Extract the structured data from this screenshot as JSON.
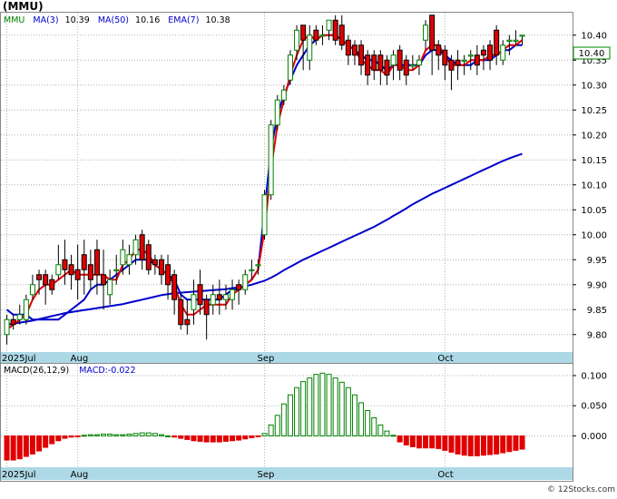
{
  "symbol": "(MMU)",
  "watermark": "© 12Stocks.com",
  "legend": {
    "ticker": "MMU",
    "ma3_label": "MA(3)",
    "ma3_value": "10.39",
    "ma50_label": "MA(50)",
    "ma50_value": "10.16",
    "ema7_label": "EMA(7)",
    "ema7_value": "10.38"
  },
  "price_tag": "10.40",
  "macd_legend": {
    "label": "MACD(26,12,9)",
    "value_text": "MACD:-0.022"
  },
  "colors": {
    "up": "#008000",
    "down": "#e00000",
    "ma_fast": "#e00000",
    "ma_slow": "#0000cc",
    "axis_band": "#add8e6",
    "grid": "#b0b0b0",
    "ticker_text": "#008000",
    "label_blue": "#0000cc"
  },
  "chart_data": [
    {
      "type": "candlestick",
      "title": "(MMU)",
      "x_labels": [
        {
          "label": "2025Jul",
          "index": 0
        },
        {
          "label": "Aug",
          "index": 11
        },
        {
          "label": "Sep",
          "index": 40
        },
        {
          "label": "Oct",
          "index": 68
        }
      ],
      "y_ticks": [
        9.8,
        9.85,
        9.9,
        9.95,
        10.0,
        10.05,
        10.1,
        10.15,
        10.2,
        10.25,
        10.3,
        10.35,
        10.4
      ],
      "ylim": [
        9.765,
        10.445
      ],
      "grid": true,
      "candles": [
        [
          9.8,
          9.83,
          9.78,
          9.84
        ],
        [
          9.83,
          9.82,
          9.81,
          9.84
        ],
        [
          9.83,
          9.84,
          9.82,
          9.86
        ],
        [
          9.83,
          9.87,
          9.82,
          9.88
        ],
        [
          9.88,
          9.9,
          9.87,
          9.92
        ],
        [
          9.92,
          9.91,
          9.88,
          9.93
        ],
        [
          9.92,
          9.9,
          9.86,
          9.93
        ],
        [
          9.91,
          9.89,
          9.88,
          9.92
        ],
        [
          9.92,
          9.94,
          9.91,
          9.98
        ],
        [
          9.95,
          9.93,
          9.9,
          9.99
        ],
        [
          9.94,
          9.92,
          9.89,
          9.96
        ],
        [
          9.93,
          9.91,
          9.87,
          9.98
        ],
        [
          9.96,
          9.93,
          9.88,
          9.99
        ],
        [
          9.94,
          9.91,
          9.89,
          9.97
        ],
        [
          9.97,
          9.92,
          9.88,
          9.99
        ],
        [
          9.92,
          9.9,
          9.85,
          9.97
        ],
        [
          9.88,
          9.91,
          9.86,
          9.93
        ],
        [
          9.93,
          9.93,
          9.9,
          9.96
        ],
        [
          9.94,
          9.97,
          9.92,
          9.99
        ],
        [
          9.94,
          9.96,
          9.92,
          9.98
        ],
        [
          9.96,
          9.99,
          9.94,
          10.0
        ],
        [
          10.0,
          9.95,
          9.93,
          10.01
        ],
        [
          9.98,
          9.93,
          9.92,
          9.99
        ],
        [
          9.95,
          9.94,
          9.92,
          9.96
        ],
        [
          9.95,
          9.92,
          9.9,
          9.96
        ],
        [
          9.94,
          9.9,
          9.87,
          9.96
        ],
        [
          9.92,
          9.87,
          9.84,
          9.93
        ],
        [
          9.87,
          9.82,
          9.81,
          9.88
        ],
        [
          9.83,
          9.82,
          9.8,
          9.87
        ],
        [
          9.85,
          9.88,
          9.82,
          9.91
        ],
        [
          9.9,
          9.86,
          9.84,
          9.93
        ],
        [
          9.87,
          9.84,
          9.79,
          9.88
        ],
        [
          9.86,
          9.88,
          9.84,
          9.9
        ],
        [
          9.88,
          9.87,
          9.84,
          9.91
        ],
        [
          9.87,
          9.88,
          9.85,
          9.9
        ],
        [
          9.87,
          9.89,
          9.85,
          9.91
        ],
        [
          9.9,
          9.89,
          9.86,
          9.91
        ],
        [
          9.89,
          9.92,
          9.88,
          9.93
        ],
        [
          9.93,
          9.93,
          9.91,
          9.95
        ],
        [
          9.94,
          9.94,
          9.92,
          9.95
        ],
        [
          10.0,
          10.08,
          9.99,
          10.09
        ],
        [
          10.08,
          10.22,
          10.07,
          10.23
        ],
        [
          10.22,
          10.27,
          10.21,
          10.28
        ],
        [
          10.27,
          10.29,
          10.26,
          10.3
        ],
        [
          10.31,
          10.36,
          10.3,
          10.37
        ],
        [
          10.37,
          10.41,
          10.35,
          10.42
        ],
        [
          10.42,
          10.39,
          10.33,
          10.42
        ],
        [
          10.35,
          10.4,
          10.33,
          10.42
        ],
        [
          10.41,
          10.39,
          10.38,
          10.42
        ],
        [
          10.4,
          10.4,
          10.38,
          10.42
        ],
        [
          10.41,
          10.43,
          10.39,
          10.43
        ],
        [
          10.43,
          10.39,
          10.38,
          10.44
        ],
        [
          10.42,
          10.38,
          10.37,
          10.44
        ],
        [
          10.39,
          10.36,
          10.34,
          10.4
        ],
        [
          10.38,
          10.36,
          10.34,
          10.39
        ],
        [
          10.38,
          10.34,
          10.32,
          10.39
        ],
        [
          10.36,
          10.32,
          10.3,
          10.37
        ],
        [
          10.36,
          10.33,
          10.31,
          10.37
        ],
        [
          10.36,
          10.33,
          10.3,
          10.37
        ],
        [
          10.35,
          10.32,
          10.3,
          10.36
        ],
        [
          10.34,
          10.36,
          10.31,
          10.37
        ],
        [
          10.37,
          10.33,
          10.31,
          10.38
        ],
        [
          10.35,
          10.32,
          10.3,
          10.36
        ],
        [
          10.34,
          10.34,
          10.33,
          10.36
        ],
        [
          10.34,
          10.35,
          10.32,
          10.36
        ],
        [
          10.39,
          10.42,
          10.37,
          10.43
        ],
        [
          10.44,
          10.37,
          10.32,
          10.44
        ],
        [
          10.38,
          10.36,
          10.33,
          10.39
        ],
        [
          10.37,
          10.34,
          10.31,
          10.38
        ],
        [
          10.35,
          10.33,
          10.29,
          10.36
        ],
        [
          10.35,
          10.34,
          10.31,
          10.37
        ],
        [
          10.35,
          10.35,
          10.32,
          10.36
        ],
        [
          10.36,
          10.36,
          10.33,
          10.37
        ],
        [
          10.36,
          10.34,
          10.32,
          10.38
        ],
        [
          10.37,
          10.36,
          10.33,
          10.38
        ],
        [
          10.38,
          10.35,
          10.33,
          10.39
        ],
        [
          10.41,
          10.36,
          10.34,
          10.42
        ],
        [
          10.35,
          10.38,
          10.34,
          10.39
        ],
        [
          10.39,
          10.39,
          10.36,
          10.4
        ],
        [
          10.39,
          10.39,
          10.38,
          10.41
        ],
        [
          10.4,
          10.4,
          10.38,
          10.4
        ]
      ],
      "ma3": [
        9.81,
        9.82,
        9.83,
        9.84,
        9.87,
        9.89,
        9.9,
        9.9,
        9.91,
        9.92,
        9.93,
        9.92,
        9.92,
        9.92,
        9.92,
        9.92,
        9.91,
        9.91,
        9.94,
        9.95,
        9.97,
        9.97,
        9.96,
        9.94,
        9.93,
        9.92,
        9.9,
        9.86,
        9.84,
        9.84,
        9.85,
        9.86,
        9.86,
        9.86,
        9.86,
        9.88,
        9.89,
        9.9,
        9.91,
        9.93,
        10.01,
        10.13,
        10.22,
        10.27,
        10.32,
        10.36,
        10.39,
        10.4,
        10.39,
        10.4,
        10.4,
        10.4,
        10.39,
        10.38,
        10.37,
        10.35,
        10.34,
        10.33,
        10.33,
        10.32,
        10.34,
        10.34,
        10.33,
        10.33,
        10.34,
        10.37,
        10.38,
        10.38,
        10.36,
        10.34,
        10.34,
        10.34,
        10.35,
        10.35,
        10.35,
        10.36,
        10.36,
        10.37,
        10.38,
        10.38,
        10.39
      ],
      "ema7": [
        9.85,
        9.84,
        9.84,
        9.84,
        9.83,
        9.83,
        9.83,
        9.83,
        9.83,
        9.84,
        9.85,
        9.86,
        9.87,
        9.89,
        9.9,
        9.9,
        9.91,
        9.92,
        9.93,
        9.94,
        9.95,
        9.95,
        9.95,
        9.94,
        9.93,
        9.92,
        9.91,
        9.88,
        9.87,
        9.87,
        9.87,
        9.87,
        9.87,
        9.87,
        9.88,
        9.89,
        9.89,
        9.9,
        9.91,
        9.93,
        10.05,
        10.17,
        10.24,
        10.28,
        10.31,
        10.34,
        10.36,
        10.38,
        10.39,
        10.4,
        10.4,
        10.4,
        10.39,
        10.38,
        10.37,
        10.36,
        10.35,
        10.35,
        10.34,
        10.33,
        10.34,
        10.34,
        10.34,
        10.34,
        10.34,
        10.36,
        10.37,
        10.37,
        10.36,
        10.35,
        10.34,
        10.34,
        10.34,
        10.35,
        10.35,
        10.35,
        10.36,
        10.37,
        10.37,
        10.38,
        10.38
      ],
      "ma50": [
        9.82,
        9.822,
        9.824,
        9.826,
        9.828,
        9.831,
        9.834,
        9.837,
        9.84,
        9.843,
        9.845,
        9.847,
        9.849,
        9.851,
        9.853,
        9.855,
        9.857,
        9.859,
        9.861,
        9.864,
        9.867,
        9.87,
        9.873,
        9.876,
        9.879,
        9.881,
        9.883,
        9.884,
        9.885,
        9.886,
        9.887,
        9.888,
        9.889,
        9.89,
        9.891,
        9.893,
        9.895,
        9.897,
        9.9,
        9.904,
        9.908,
        9.914,
        9.921,
        9.929,
        9.936,
        9.943,
        9.95,
        9.956,
        9.962,
        9.968,
        9.974,
        9.98,
        9.986,
        9.992,
        9.998,
        10.004,
        10.01,
        10.016,
        10.023,
        10.03,
        10.038,
        10.045,
        10.053,
        10.061,
        10.068,
        10.075,
        10.082,
        10.088,
        10.094,
        10.1,
        10.106,
        10.112,
        10.118,
        10.124,
        10.13,
        10.136,
        10.142,
        10.148,
        10.153,
        10.158,
        10.162
      ]
    },
    {
      "type": "bar",
      "title": "MACD(26,12,9)",
      "y_ticks": [
        0.1,
        0.05,
        0.0
      ],
      "ylim": [
        -0.052,
        0.118
      ],
      "grid": true,
      "values": [
        -0.04,
        -0.04,
        -0.038,
        -0.034,
        -0.03,
        -0.025,
        -0.019,
        -0.013,
        -0.008,
        -0.004,
        -0.002,
        -0.001,
        0.001,
        0.002,
        0.002,
        0.003,
        0.003,
        0.002,
        0.002,
        0.003,
        0.004,
        0.005,
        0.005,
        0.004,
        0.002,
        0.0,
        -0.002,
        -0.004,
        -0.006,
        -0.008,
        -0.009,
        -0.01,
        -0.01,
        -0.01,
        -0.009,
        -0.008,
        -0.007,
        -0.005,
        -0.003,
        -0.001,
        0.004,
        0.018,
        0.034,
        0.053,
        0.068,
        0.08,
        0.09,
        0.096,
        0.102,
        0.104,
        0.102,
        0.096,
        0.089,
        0.08,
        0.068,
        0.055,
        0.042,
        0.03,
        0.018,
        0.008,
        0.001,
        -0.01,
        -0.015,
        -0.018,
        -0.02,
        -0.02,
        -0.02,
        -0.021,
        -0.024,
        -0.027,
        -0.03,
        -0.032,
        -0.033,
        -0.033,
        -0.032,
        -0.031,
        -0.03,
        -0.028,
        -0.026,
        -0.024,
        -0.022
      ]
    }
  ]
}
